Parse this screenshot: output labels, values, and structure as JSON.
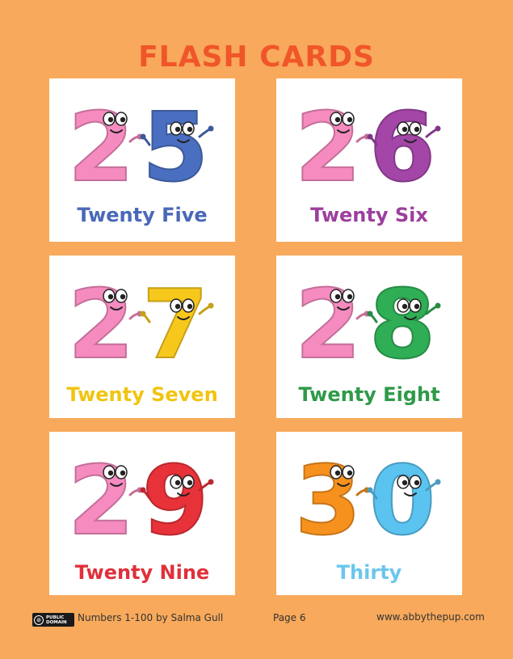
{
  "page_title": "FLASH CARDS",
  "cards": [
    {
      "left_digit": "2",
      "right_digit": "5",
      "label": "Twenty Five",
      "left_color": "#f58bbf",
      "right_color": "#4a6fc0",
      "label_color": "#4a68b8"
    },
    {
      "left_digit": "2",
      "right_digit": "6",
      "label": "Twenty Six",
      "left_color": "#f58bbf",
      "right_color": "#a346a8",
      "label_color": "#9c3f9e"
    },
    {
      "left_digit": "2",
      "right_digit": "7",
      "label": "Twenty Seven",
      "left_color": "#f58bbf",
      "right_color": "#f7c81c",
      "label_color": "#f1c40f"
    },
    {
      "left_digit": "2",
      "right_digit": "8",
      "label": "Twenty Eight",
      "left_color": "#f58bbf",
      "right_color": "#2fae55",
      "label_color": "#2e9a48"
    },
    {
      "left_digit": "2",
      "right_digit": "9",
      "label": "Twenty Nine",
      "left_color": "#f58bbf",
      "right_color": "#e8323a",
      "label_color": "#e0303a"
    },
    {
      "left_digit": "3",
      "right_digit": "0",
      "label": "Thirty",
      "left_color": "#f7911e",
      "right_color": "#5bc3f0",
      "label_color": "#6bc6ee"
    }
  ],
  "footer": {
    "license_badge_lines": [
      "PUBLIC",
      "DOMAIN"
    ],
    "credit": "Numbers 1-100 by Salma Gull",
    "page": "Page 6",
    "website": "www.abbythepup.com"
  }
}
